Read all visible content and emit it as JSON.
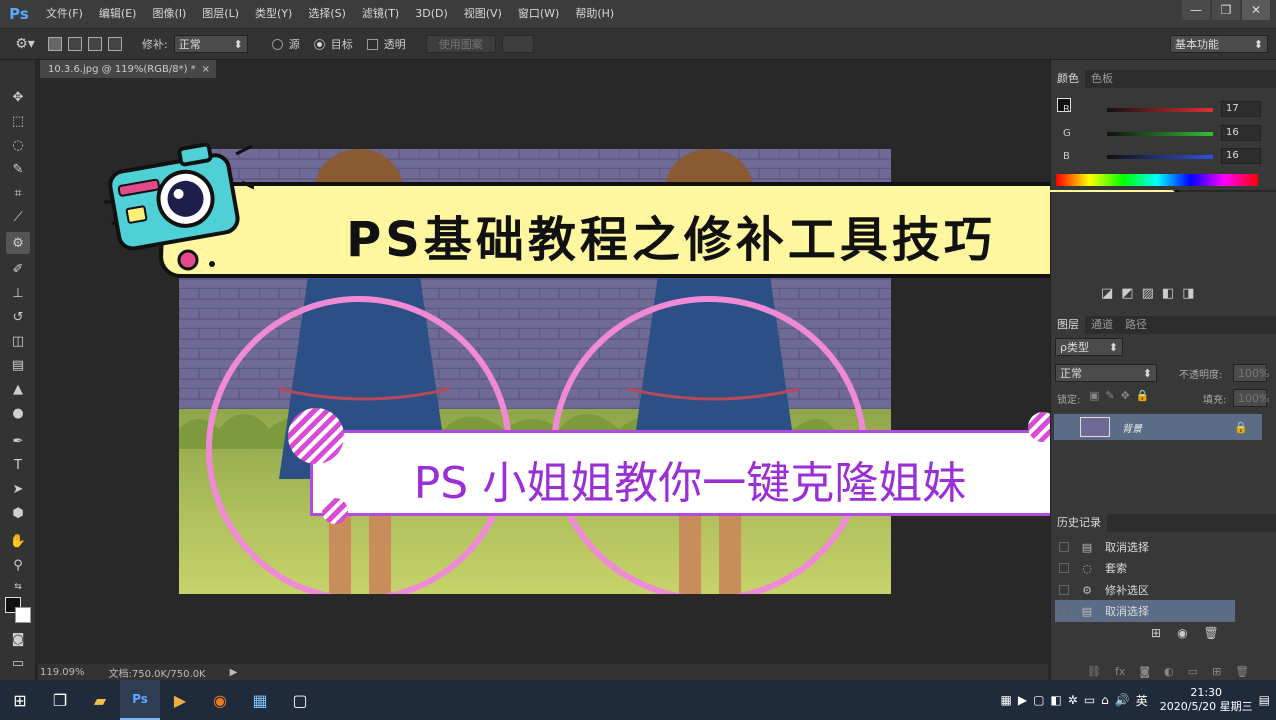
{
  "app": {
    "logo": "Ps",
    "menu": [
      "文件(F)",
      "编辑(E)",
      "图像(I)",
      "图层(L)",
      "类型(Y)",
      "选择(S)",
      "滤镜(T)",
      "3D(D)",
      "视图(V)",
      "窗口(W)",
      "帮助(H)"
    ],
    "window_controls": [
      "—",
      "❐",
      "✕"
    ]
  },
  "options": {
    "patch_label": "修补:",
    "patch_mode": "正常",
    "source_label": "源",
    "target_label": "目标",
    "transparent_label": "透明",
    "use_pattern_label": "使用图案",
    "workspace": "基本功能"
  },
  "document": {
    "tab_title": "10.3.6.jpg @ 119%(RGB/8*) *",
    "zoom": "119.09%",
    "doc_size": "文档:750.0K/750.0K"
  },
  "overlay": {
    "title": "PS基础教程之修补工具技巧",
    "subtitle": "PS 小姐姐教你一键克隆姐妹"
  },
  "color_panel": {
    "tabs": [
      "颜色",
      "色板"
    ],
    "channels": [
      {
        "label": "R",
        "value": "17",
        "color": "#e03030"
      },
      {
        "label": "G",
        "value": "16",
        "color": "#30c030"
      },
      {
        "label": "B",
        "value": "16",
        "color": "#3050e0"
      }
    ]
  },
  "layers_panel": {
    "tabs": [
      "图层",
      "通道",
      "路径"
    ],
    "kind_filter": "ρ类型",
    "blend_mode": "正常",
    "opacity_label": "不透明度:",
    "opacity_value": "100%",
    "lock_label": "锁定:",
    "fill_label": "填充:",
    "fill_value": "100%",
    "layer_name": "背景"
  },
  "history_panel": {
    "tab": "历史记录",
    "items": [
      {
        "label": "取消选择",
        "icon": "doc-icon"
      },
      {
        "label": "套索",
        "icon": "lasso-icon"
      },
      {
        "label": "修补选区",
        "icon": "patch-icon"
      },
      {
        "label": "取消选择",
        "icon": "doc-icon"
      }
    ]
  },
  "taskbar": {
    "ime": "英",
    "time": "21:30",
    "date": "2020/5/20 星期三"
  }
}
